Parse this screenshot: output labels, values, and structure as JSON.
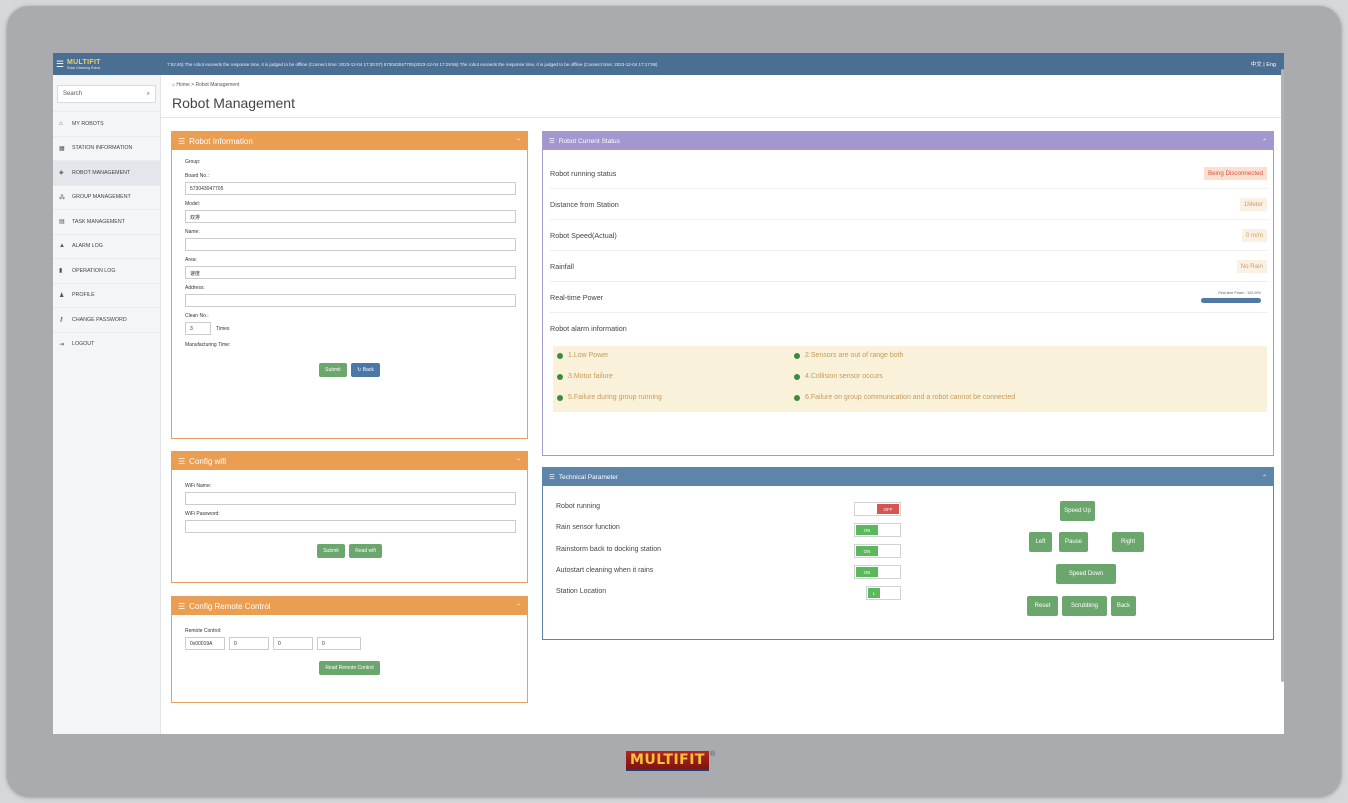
{
  "topbar": {
    "logo": "MULTIFIT",
    "logo_sub": "Solar Cleaning Robot",
    "marquee": "7:52:40) The robot exceeds the response time, it is judged to be offline (Connect time: 2023-12-04 17:30:07)    573043047705(2023-12-04 17:29:56) The robot exceeds the response time, it is judged to be offline (Connect time: 2023-12-04 17:17:06)",
    "lang": "中文 | Eng"
  },
  "sidebar": {
    "search_placeholder": "Search",
    "items": [
      {
        "label": "MY ROBOTS",
        "icon": "home-icon"
      },
      {
        "label": "STATION INFORMATION",
        "icon": "station-icon"
      },
      {
        "label": "ROBOT MANAGEMENT",
        "icon": "robot-icon"
      },
      {
        "label": "GROUP MANAGEMENT",
        "icon": "group-icon"
      },
      {
        "label": "TASK MANAGEMENT",
        "icon": "task-icon"
      },
      {
        "label": "ALARM LOG",
        "icon": "alarm-icon"
      },
      {
        "label": "OPERATION LOG",
        "icon": "file-icon"
      },
      {
        "label": "PROFILE",
        "icon": "user-icon"
      },
      {
        "label": "CHANGE PASSWORD",
        "icon": "key-icon"
      },
      {
        "label": "LOGOUT",
        "icon": "logout-icon"
      }
    ]
  },
  "breadcrumb": {
    "home": "Home",
    "sep": ">",
    "current": "Robot Management"
  },
  "page_title": "Robot Management",
  "robot_info": {
    "title": "Robot Information",
    "group_label": "Group:",
    "board_label": "Board No.:",
    "board_value": "573043047705",
    "model_label": "Model:",
    "model_value": "双排",
    "name_label": "Name:",
    "name_value": "",
    "area_label": "Area:",
    "area_value": "速度",
    "address_label": "Address:",
    "address_value": "",
    "clean_label": "Clean No.:",
    "clean_value": "3",
    "clean_unit": "Times",
    "mfg_label": "Manufacturing Time:",
    "submit": "Submit",
    "back": "Back"
  },
  "config_wifi": {
    "title": "Config wifi",
    "name_label": "WiFi Name:",
    "password_label": "WiFi Password:",
    "submit": "Submit",
    "read": "Read wifi"
  },
  "config_remote": {
    "title": "Config Remote Control",
    "label": "Remote Control:",
    "values": [
      "0x00019A",
      "0",
      "0",
      "0"
    ],
    "read": "Read Remote Control"
  },
  "current_status": {
    "title": "Robot Current Status",
    "rows": [
      {
        "label": "Robot running status",
        "value": "Being Disconnected"
      },
      {
        "label": "Distance from Station",
        "value": "1Meter"
      },
      {
        "label": "Robot Speed(Actual)",
        "value": "0 m/m"
      },
      {
        "label": "Rainfall",
        "value": "No Rain"
      },
      {
        "label": "Real-time Power",
        "value": ""
      }
    ],
    "power_label": "Real-time Power : 100.00%",
    "power_fraction": 1.0,
    "alarm_title": "Robot alarm information",
    "alarms": [
      "1.Low Power",
      "2.Sensors are out of range both",
      "3.Motor failure",
      "4.Collision sensor occurs",
      "5.Failure during group running",
      "6.Failure on group communication and a robot cannot be connected"
    ],
    "colors": {
      "alarm_dot": "#3d8b3d",
      "alert": "#d9534f"
    }
  },
  "technical": {
    "title": "Technical Parameter",
    "params": [
      {
        "label": "Robot running",
        "state": "OFF"
      },
      {
        "label": "Rain sensor function",
        "state": "ON"
      },
      {
        "label": "Rainstorm back to docking station",
        "state": "ON"
      },
      {
        "label": "Autostart cleaning when it rains",
        "state": "ON"
      },
      {
        "label": "Station Location",
        "state": "L"
      }
    ],
    "buttons": {
      "speed_up": "Speed Up",
      "left": "Left",
      "pause": "Pause",
      "right": "Right",
      "speed_down": "Speed Down",
      "reset": "Reset",
      "scrubbing": "Scrubbing",
      "back": "Back"
    }
  },
  "brand": {
    "name": "MULTIFIT",
    "reg": "®"
  }
}
